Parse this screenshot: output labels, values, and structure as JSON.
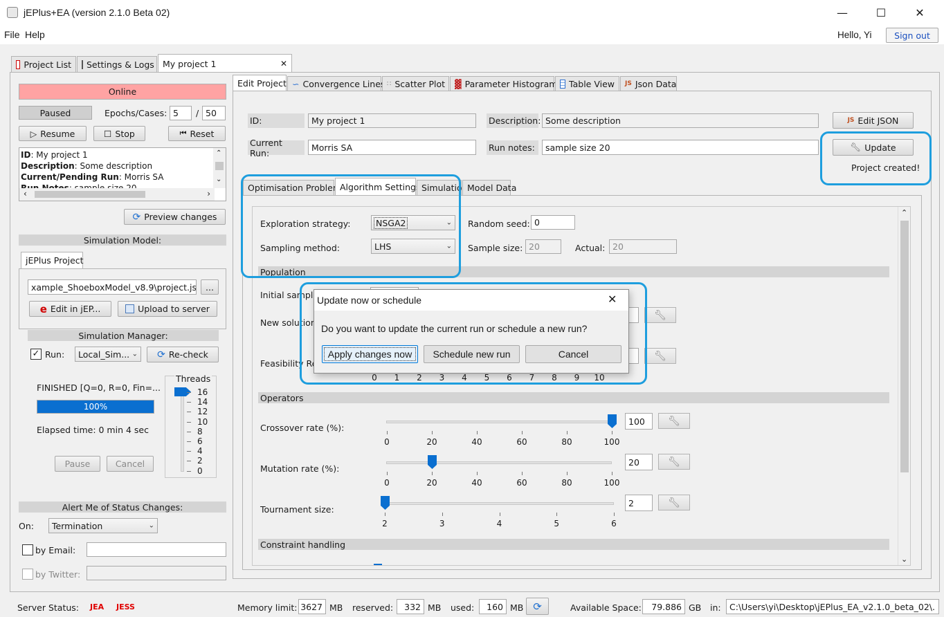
{
  "window": {
    "title": "jEPlus+EA (version 2.1.0 Beta 02)"
  },
  "menu": {
    "file": "File",
    "help": "Help",
    "greeting": "Hello, Yi",
    "sign_out": "Sign out"
  },
  "main_tabs": [
    {
      "label": "Project List"
    },
    {
      "label": "Settings & Logs"
    },
    {
      "label": "My project 1"
    }
  ],
  "left": {
    "online": "Online",
    "paused": "Paused",
    "epochs_label": "Epochs/Cases:",
    "epochs_value": "5",
    "epochs_sep": "/",
    "epochs_total": "50",
    "resume": "Resume",
    "stop": "Stop",
    "reset": "Reset",
    "info": {
      "id_key": "ID",
      "id_val": ": My project 1",
      "desc_key": "Description",
      "desc_val": ": Some description",
      "run_key": "Current/Pending Run",
      "run_val": ": Morris SA",
      "notes_key": "Run Notes",
      "notes_val": ": sample size 20"
    },
    "preview_changes": "Preview changes",
    "sim_model_header": "Simulation Model:",
    "jeplus_tab": "jEPlus Project",
    "project_path": "xample_ShoeboxModel_v8.9\\project.json",
    "browse": "...",
    "edit_in_jep": "Edit in jEP...",
    "upload": "Upload to server",
    "sim_manager_header": "Simulation Manager:",
    "run_label": "Run:",
    "run_combo": "Local_Sim...",
    "recheck": "Re-check",
    "finished": "FINISHED [Q=0, R=0, Fin=...",
    "progress_text": "100%",
    "progress_value": 1.0,
    "elapsed": "Elapsed time: 0 min 4 sec",
    "pause": "Pause",
    "cancel": "Cancel",
    "threads_label": "Threads",
    "threads_ticks": [
      "16",
      "14",
      "12",
      "10",
      "8",
      "6",
      "4",
      "2",
      "0"
    ],
    "alert_header": "Alert Me of Status Changes:",
    "on_label": "On:",
    "on_combo": "Termination",
    "by_email": "by Email:",
    "by_twitter": "by Twitter:"
  },
  "right_tabs": [
    {
      "label": "Edit Project"
    },
    {
      "label": "Convergence Lines"
    },
    {
      "label": "Scatter Plot"
    },
    {
      "label": "Parameter Histogram"
    },
    {
      "label": "Table View"
    },
    {
      "label": "Json Data"
    }
  ],
  "edit": {
    "id_label": "ID:",
    "id_value": "My project 1",
    "desc_label": "Description:",
    "desc_value": "Some description",
    "edit_json": "Edit JSON",
    "current_run_label": "Current Run:",
    "current_run_value": "Morris SA",
    "run_notes_label": "Run notes:",
    "run_notes_value": "sample size 20",
    "update": "Update",
    "project_created": "Project created!"
  },
  "sub_tabs": [
    {
      "label": "Optimisation Problem"
    },
    {
      "label": "Algorithm Settings"
    },
    {
      "label": "Simulation"
    },
    {
      "label": "Model Data"
    }
  ],
  "algo": {
    "exploration_label": "Exploration strategy:",
    "exploration_value": "NSGA2",
    "random_seed_label": "Random seed:",
    "random_seed_value": "0",
    "sampling_label": "Sampling method:",
    "sampling_value": "LHS",
    "sample_size_label": "Sample size:",
    "sample_size_value": "20",
    "actual_label": "Actual:",
    "actual_value": "20",
    "population_header": "Population",
    "initial_sample_label": "Initial sample",
    "new_solutions_label": "New solutions",
    "feasibility_label": "Feasibility Rel",
    "feas_ticks": [
      "0",
      "1",
      "2",
      "3",
      "4",
      "5",
      "6",
      "7",
      "8",
      "9",
      "10"
    ],
    "operators_header": "Operators",
    "crossover_label": "Crossover rate (%):",
    "crossover_value": "100",
    "crossover_level": 100,
    "mutation_label": "Mutation rate (%):",
    "mutation_value": "20",
    "mutation_level": 20,
    "rate_ticks": [
      "0",
      "20",
      "40",
      "60",
      "80",
      "100"
    ],
    "tournament_label": "Tournament size:",
    "tournament_value": "2",
    "tournament_level": 2,
    "tour_ticks": [
      "2",
      "3",
      "4",
      "5",
      "6"
    ],
    "constraint_header": "Constraint handling"
  },
  "dialog": {
    "title": "Update now or schedule",
    "message": "Do you want to update the current run or schedule a new run?",
    "apply": "Apply changes now",
    "schedule": "Schedule new run",
    "cancel": "Cancel"
  },
  "status": {
    "server_status": "Server Status:",
    "jea": "JEA",
    "jess": "JESS",
    "memory_limit": "Memory limit:",
    "memory_limit_val": "3627",
    "mb1": "MB",
    "reserved": "reserved:",
    "reserved_val": "332",
    "mb2": "MB",
    "used": "used:",
    "used_val": "160",
    "mb3": "MB",
    "available": "Available Space:",
    "available_val": "79.886",
    "gb": "GB",
    "in": "in:",
    "path": "C:\\Users\\yi\\Desktop\\jEPlus_EA_v2.1.0_beta_02\\."
  },
  "colors": {
    "online_bg": "#ffa3a3",
    "accent": "#0a6fd0",
    "highlight": "#1e9ede",
    "server_red": "#e00000"
  }
}
